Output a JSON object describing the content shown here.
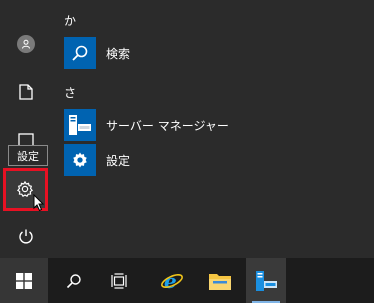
{
  "start_menu": {
    "groups": [
      {
        "header": "か",
        "apps": [
          {
            "label": "検索",
            "icon": "search-icon"
          }
        ]
      },
      {
        "header": "さ",
        "apps": [
          {
            "label": "サーバー マネージャー",
            "icon": "server-manager-icon"
          },
          {
            "label": "設定",
            "icon": "gear-icon"
          }
        ]
      }
    ],
    "rail": {
      "items": [
        "user-avatar-icon",
        "documents-icon",
        "pictures-icon",
        "settings-icon",
        "power-icon"
      ],
      "tooltip": "設定"
    }
  },
  "taskbar": {
    "items": [
      "windows-start-icon",
      "search-icon",
      "task-view-icon",
      "internet-explorer-icon",
      "file-explorer-icon",
      "server-manager-icon"
    ],
    "active": "server-manager-icon"
  },
  "colors": {
    "accent": "#0063b1",
    "highlight": "#e81123",
    "background": "#2b2b2b",
    "taskbar": "#1c1c1c"
  }
}
